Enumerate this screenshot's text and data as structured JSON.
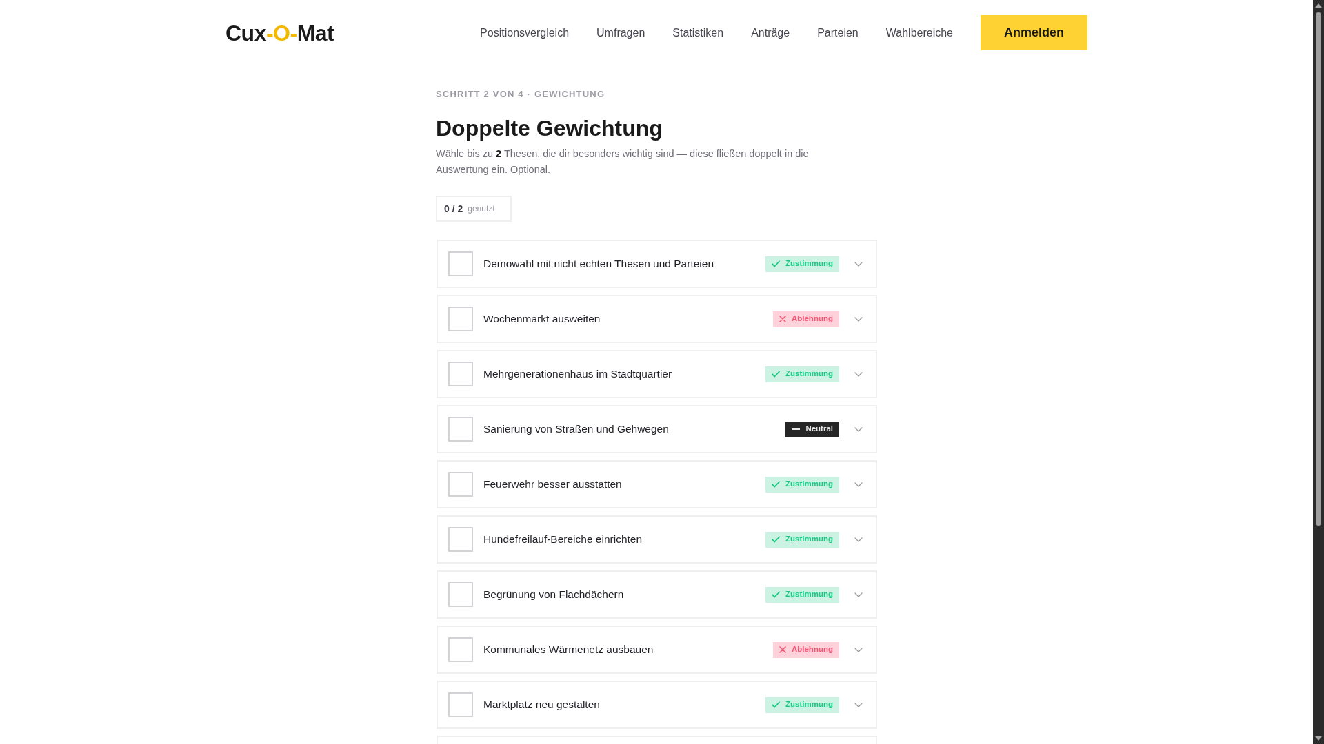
{
  "header": {
    "logo": [
      {
        "text": "Cux",
        "accent": false
      },
      {
        "text": "-O-",
        "accent": true
      },
      {
        "text": "Mat",
        "accent": false
      }
    ],
    "nav": [
      "Positionsvergleich",
      "Umfragen",
      "Statistiken",
      "Anträge",
      "Parteien",
      "Wahlbereiche"
    ],
    "login_button": "Anmelden"
  },
  "step": "SCHRITT 2 VON 4 · GEWICHTUNG",
  "title": "Doppelte Gewichtung",
  "intro": "Wähle bis zu **2** Thesen, die dir besonders wichtig sind — diese fließen doppelt in die Auswertung ein. Optional.",
  "counter": {
    "value": "0 / 2",
    "label": "genutzt"
  },
  "theses": [
    {
      "title": "Demowahl mit nicht echten Thesen und Parteien",
      "checked": false,
      "expanded": false,
      "stance": {
        "kind": "agree",
        "label": "Zustimmung"
      }
    },
    {
      "title": "Wochenmarkt ausweiten",
      "checked": false,
      "expanded": false,
      "stance": {
        "kind": "disagree",
        "label": "Ablehnung"
      }
    },
    {
      "title": "Mehrgenerationenhaus im Stadtquartier",
      "checked": false,
      "expanded": false,
      "stance": {
        "kind": "agree",
        "label": "Zustimmung"
      }
    },
    {
      "title": "Sanierung von Straßen und Gehwegen",
      "checked": false,
      "expanded": false,
      "stance": {
        "kind": "neutral",
        "label": "Neutral"
      }
    },
    {
      "title": "Feuerwehr besser ausstatten",
      "checked": false,
      "expanded": false,
      "stance": {
        "kind": "agree",
        "label": "Zustimmung"
      }
    },
    {
      "title": "Hundefreilauf-Bereiche einrichten",
      "checked": false,
      "expanded": false,
      "stance": {
        "kind": "agree",
        "label": "Zustimmung"
      }
    },
    {
      "title": "Begrünung von Flachdächern",
      "checked": false,
      "expanded": false,
      "stance": {
        "kind": "agree",
        "label": "Zustimmung"
      }
    },
    {
      "title": "Kommunales Wärmenetz ausbauen",
      "checked": false,
      "expanded": false,
      "stance": {
        "kind": "disagree",
        "label": "Ablehnung"
      }
    },
    {
      "title": "Marktplatz neu gestalten",
      "checked": false,
      "expanded": false,
      "stance": {
        "kind": "agree",
        "label": "Zustimmung"
      }
    }
  ]
}
